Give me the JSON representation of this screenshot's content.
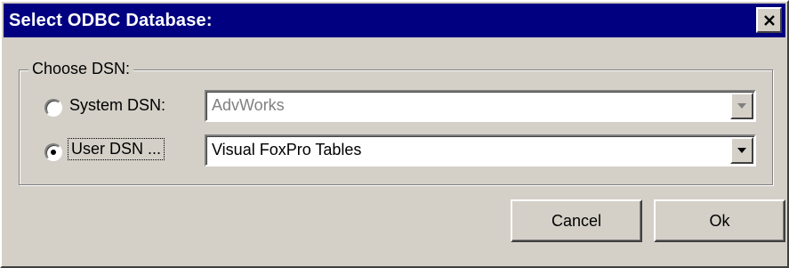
{
  "window": {
    "title": "Select ODBC Database:",
    "close_glyph": "×"
  },
  "group": {
    "legend": "Choose DSN:"
  },
  "system_dsn": {
    "label": "System DSN:",
    "selected": false,
    "value": "AdvWorks",
    "enabled": false
  },
  "user_dsn": {
    "label": "User DSN ...",
    "selected": true,
    "value": "Visual FoxPro Tables",
    "enabled": true
  },
  "buttons": {
    "cancel": "Cancel",
    "ok": "Ok"
  },
  "icons": {
    "close": "close-icon",
    "dropdown": "chevron-down-icon",
    "radio_dot": "radio-dot-icon"
  },
  "colors": {
    "titlebar": "#000080",
    "face": "#d4d0c8",
    "disabled_text": "#808080"
  }
}
